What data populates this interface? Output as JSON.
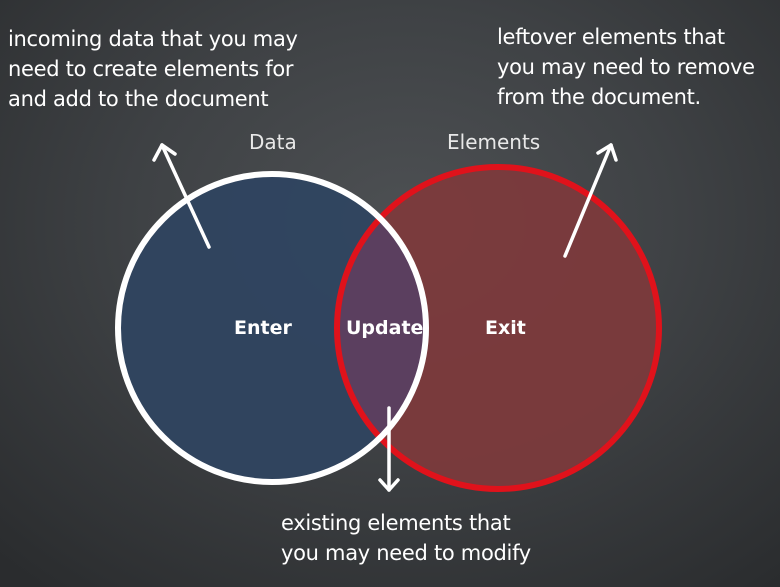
{
  "sets": {
    "data": {
      "label": "Data"
    },
    "elements": {
      "label": "Elements"
    }
  },
  "regions": {
    "enter": "Enter",
    "update": "Update",
    "exit": "Exit"
  },
  "annotations": {
    "enter": [
      "incoming data that you may",
      "need to create elements for",
      "and add to the document"
    ],
    "exit": [
      "leftover elements that",
      "you may need to remove",
      "from the document."
    ],
    "update": [
      "existing elements that",
      "you may need to modify"
    ]
  },
  "colors": {
    "data_circle_stroke": "#ffffff",
    "data_circle_fill": "#2f4560",
    "elements_circle_stroke": "#e0121b",
    "elements_circle_fill": "#7e3a3c",
    "overlap_fill": "#5b3f5f",
    "arrow": "#ffffff"
  }
}
